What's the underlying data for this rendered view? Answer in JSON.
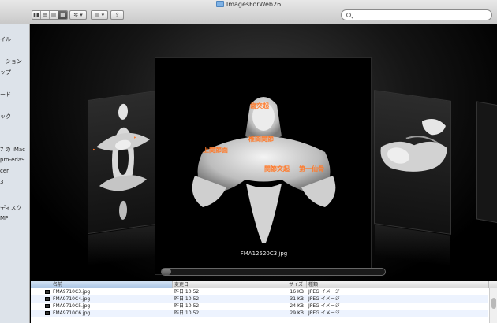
{
  "window": {
    "title": "ImagesForWeb26"
  },
  "toolbar": {
    "view_buttons": [
      "▮▮",
      "≡",
      "▥",
      "▦"
    ],
    "action_label": "✲ ▾",
    "arrange_label": "▤ ▾",
    "share_label": "⇪"
  },
  "search": {
    "placeholder": ""
  },
  "sidebar": {
    "items": [
      "イル",
      "ーション",
      "ップ",
      "ード",
      "ック",
      "7 の iMac",
      "pro-eda9",
      "cer",
      "3",
      "ディスク",
      "MP"
    ]
  },
  "coverflow": {
    "center_caption": "FMA12520C3.jpg",
    "center_labels": [
      "歯突起",
      "椎間関節",
      "上関節面",
      "関節突起",
      "第一仙骨"
    ],
    "left_labels": [
      "▸",
      "▸"
    ],
    "right_labels": [
      ""
    ]
  },
  "list": {
    "columns": [
      "名前",
      "変更日",
      "サイズ",
      "種類"
    ],
    "rows": [
      {
        "name": "FMA9710C3.jpg",
        "date": "昨日 10:52",
        "size": "16 KB",
        "kind": "JPEG イメージ"
      },
      {
        "name": "FMA9710C4.jpg",
        "date": "昨日 10:52",
        "size": "31 KB",
        "kind": "JPEG イメージ"
      },
      {
        "name": "FMA9710C5.jpg",
        "date": "昨日 10:52",
        "size": "24 KB",
        "kind": "JPEG イメージ"
      },
      {
        "name": "FMA9710C6.jpg",
        "date": "昨日 10:52",
        "size": "29 KB",
        "kind": "JPEG イメージ"
      }
    ]
  }
}
